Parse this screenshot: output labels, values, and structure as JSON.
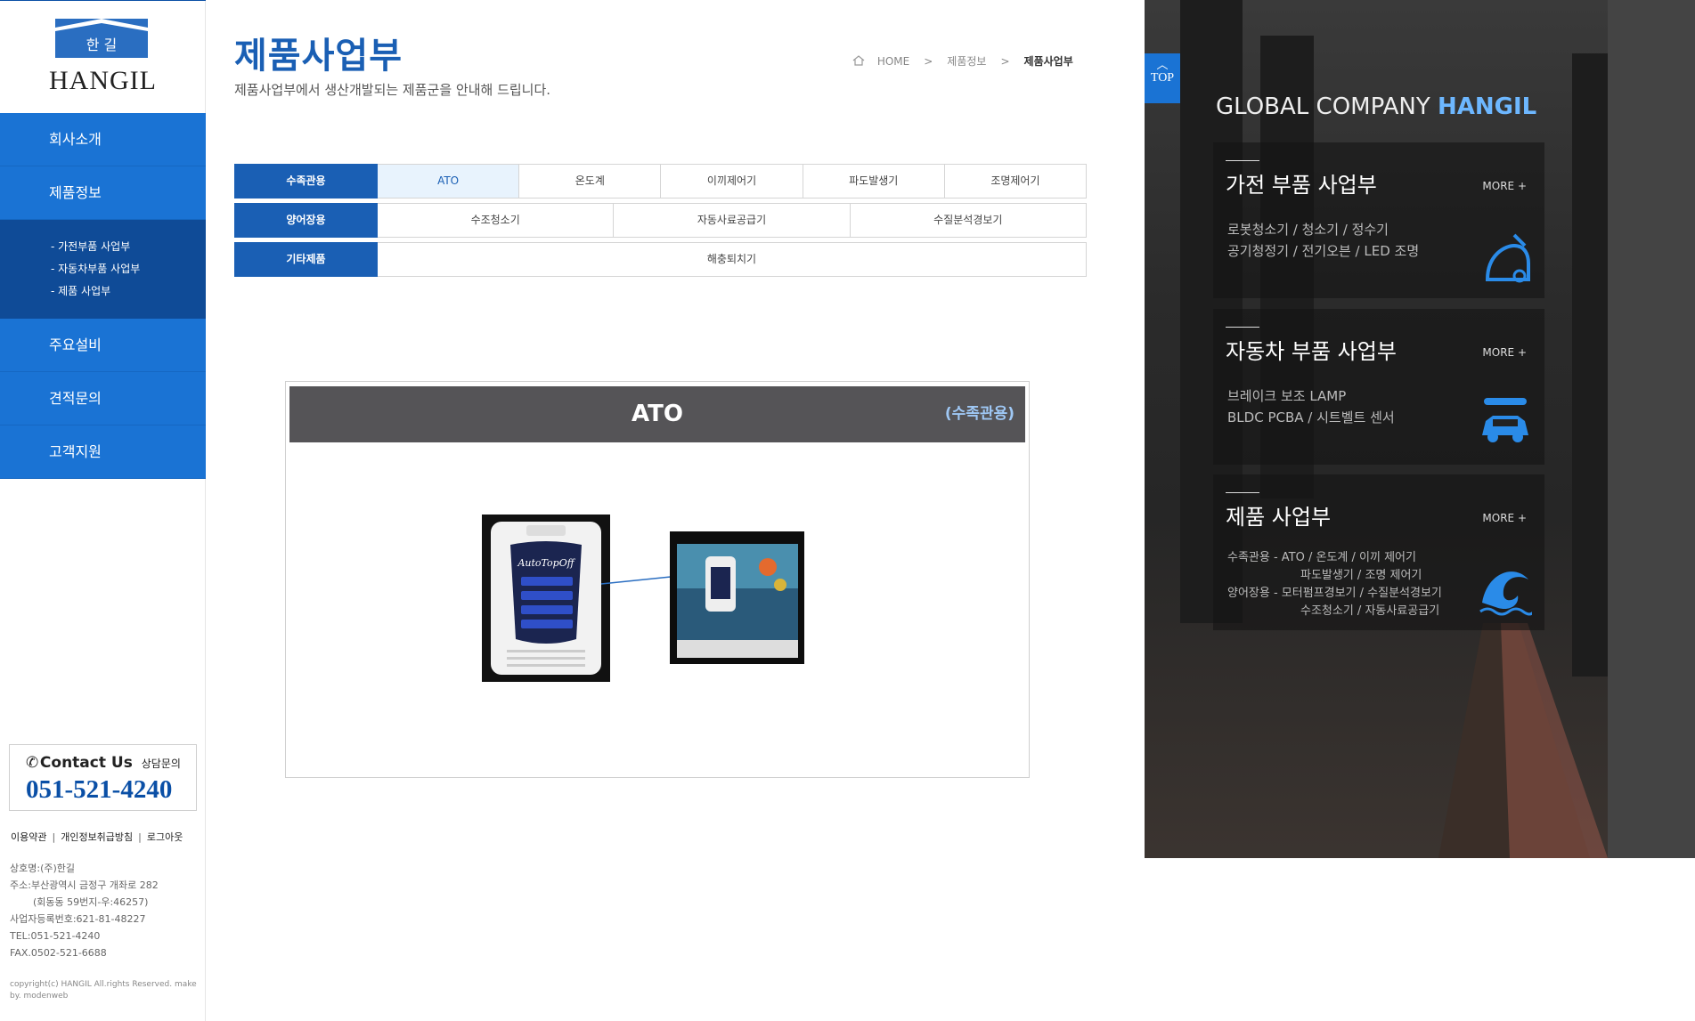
{
  "sidebar": {
    "logo_text": "HANGIL",
    "logo_hangul": "한 길",
    "nav": [
      {
        "label": "회사소개"
      },
      {
        "label": "제품정보"
      }
    ],
    "subnav": [
      "- 가전부품 사업부",
      "- 자동차부품 사업부",
      "- 제품 사업부"
    ],
    "nav2": [
      {
        "label": "주요설비"
      },
      {
        "label": "견적문의"
      },
      {
        "label": "고객지원"
      }
    ],
    "contact": {
      "title": "Contact Us",
      "sub": "상담문의",
      "phone": "051-521-4240"
    },
    "footer_links": [
      "이용약관",
      "개인정보취급방침",
      "로그아웃"
    ],
    "company_info": [
      "상호명:(주)한길",
      "주소:부산광역시 금정구 개좌로 282",
      "(회동동 59번지-우:46257)",
      "사업자등록번호:621-81-48227",
      "TEL:051-521-4240",
      "FAX.0502-521-6688"
    ],
    "copyright": "copyright(c) HANGIL All.rights Reserved. make by. modenweb"
  },
  "main": {
    "title": "제품사업부",
    "description": "제품사업부에서 생산개발되는 제품군을 안내해 드립니다.",
    "breadcrumb": [
      "HOME",
      "제품정보",
      "제품사업부"
    ],
    "categories": [
      {
        "head": "수족관용",
        "items": [
          "ATO",
          "온도계",
          "이끼제어기",
          "파도발생기",
          "조명제어기"
        ],
        "active": 0
      },
      {
        "head": "양어장용",
        "items": [
          "수조청소기",
          "자동사료공급기",
          "수질분석경보기"
        ],
        "active": -1
      },
      {
        "head": "기타제품",
        "items": [
          "해충퇴치기"
        ],
        "active": -1
      }
    ],
    "product": {
      "name": "ATO",
      "category": "(수족관용)",
      "device_brand": "AutoTopOff"
    }
  },
  "banner": {
    "top_label": "TOP",
    "title_prefix": "GLOBAL COMPANY",
    "title_brand": "HANGIL",
    "panels": [
      {
        "title": "가전 부품 사업부",
        "more": "MORE +",
        "lines": [
          "로봇청소기 / 청소기 / 정수기",
          "공기청정기 / 전기오븐 / LED 조명"
        ],
        "icon": "vacuum-cleaner-icon"
      },
      {
        "title": "자동차 부품 사업부",
        "more": "MORE +",
        "lines": [
          "브레이크 보조 LAMP",
          "BLDC PCBA / 시트벨트 센서"
        ],
        "icon": "car-wrench-icon"
      },
      {
        "title": "제품 사업부",
        "more": "MORE +",
        "lines": [
          "수족관용 - ATO / 온도계 / 이끼 제어기",
          "파도발생기 / 조명 제어기",
          "양어장용 - 모터펌프경보기 / 수질분석경보기",
          "수조청소기 / 자동사료공급기"
        ],
        "icon": "wave-icon"
      }
    ]
  },
  "colors": {
    "primary": "#1a73d4",
    "dark_blue": "#0f4b97",
    "title_blue": "#1a5fb4",
    "product_bar": "#555457"
  }
}
